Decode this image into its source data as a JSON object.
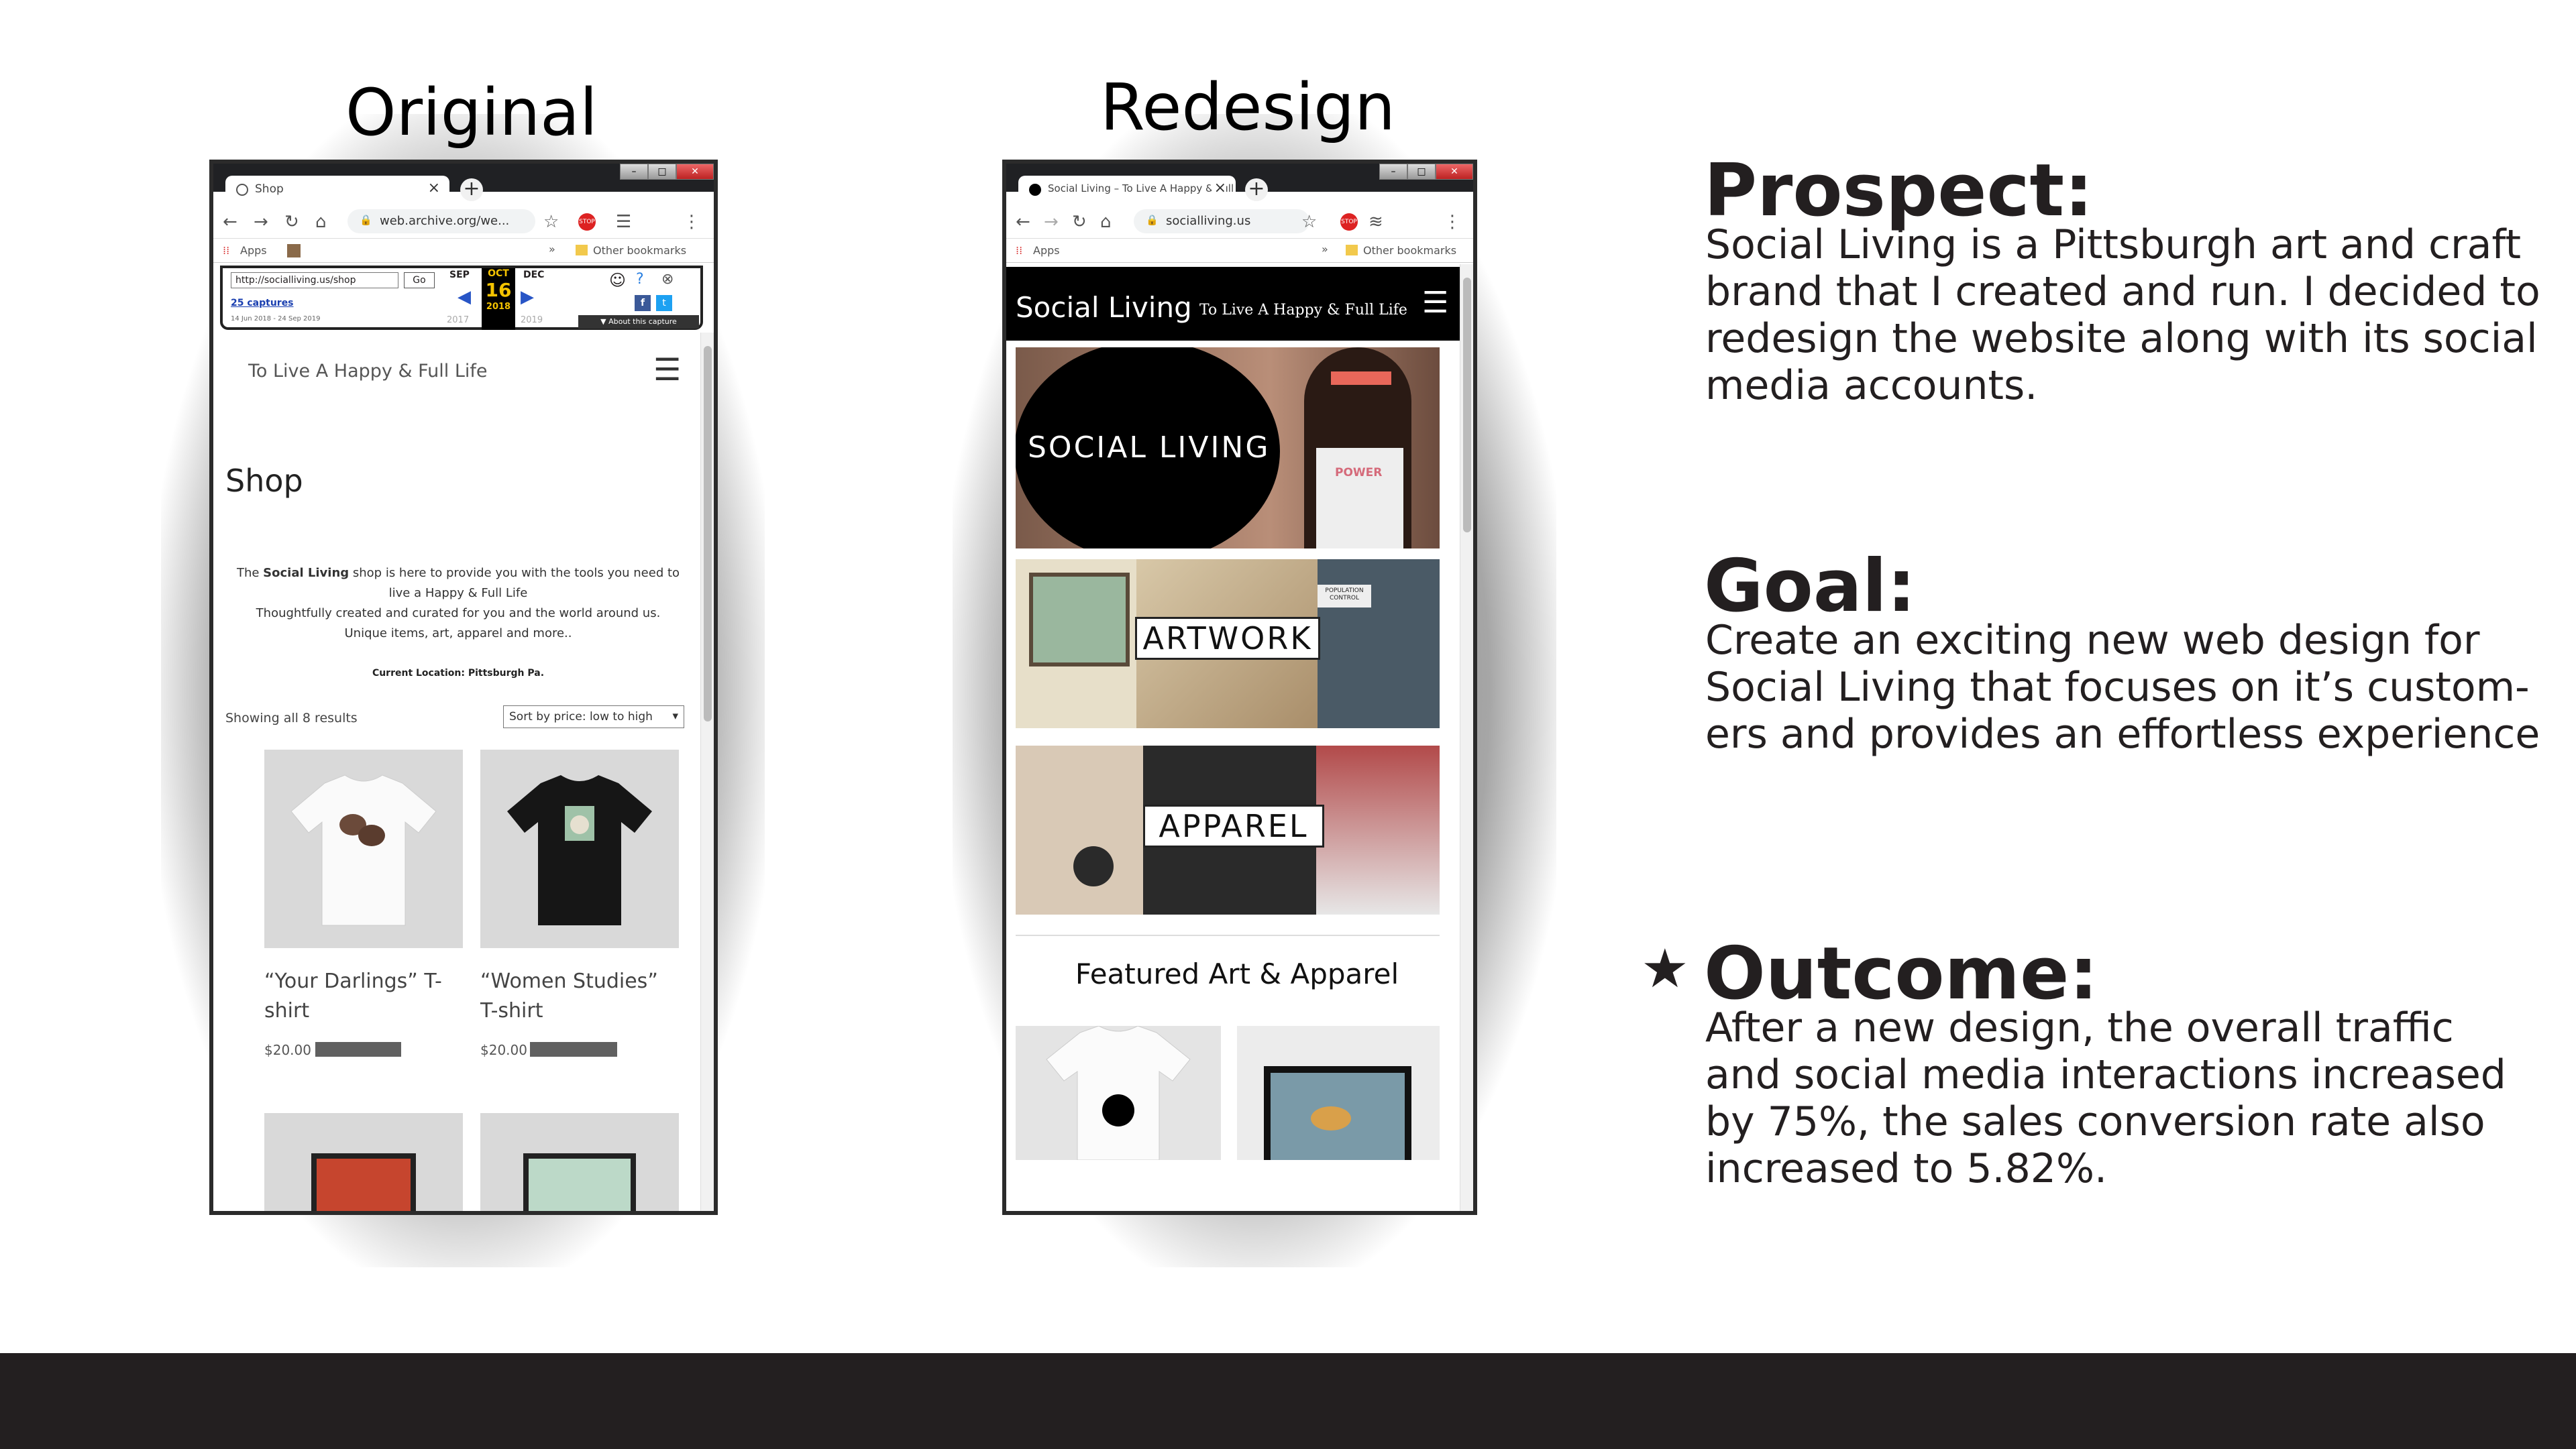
{
  "headings": {
    "original": "Original",
    "redesign": "Redesign"
  },
  "original_browser": {
    "tab_title": "Shop",
    "url": "web.archive.org/we...",
    "bookmarks": {
      "apps": "Apps",
      "other": "Other bookmarks"
    },
    "wayback": {
      "input_value": "http://socialliving.us/shop",
      "go": "Go",
      "captures": "25 captures",
      "date_range": "14 Jun 2018 - 24 Sep 2019",
      "months": [
        "SEP",
        "OCT",
        "DEC"
      ],
      "day": "16",
      "years": [
        "2017",
        "2018",
        "2019"
      ],
      "about": "About this capture"
    },
    "page": {
      "tagline": "To Live A Happy & Full Life",
      "title": "Shop",
      "intro_prefix": "The ",
      "intro_brand": "Social Living",
      "intro_rest": " shop is here to provide you with the tools you need to live a Happy & Full Life",
      "intro_line2": "Thoughtfully created and curated for you and the world around us.",
      "intro_line3": "Unique items, art, apparel and more..",
      "location": "Current Location: Pittsburgh Pa.",
      "results": "Showing all 8 results",
      "sort": "Sort by price: low to high",
      "products": [
        {
          "title": "“Your Darlings” T-shirt",
          "price": "$20.00"
        },
        {
          "title": "“Women Studies” T-shirt",
          "price": "$20.00"
        }
      ]
    }
  },
  "redesign_browser": {
    "tab_title": "Social Living – To Live A Happy & Full Life",
    "url": "socialliving.us",
    "bookmarks": {
      "apps": "Apps",
      "other": "Other bookmarks"
    },
    "page": {
      "brand": "Social Living",
      "tagline": "To Live A Happy & Full Life",
      "hero_logo": "SOCIAL LIVING",
      "shirt_text": "POWER",
      "artwork_label": "ARTWORK",
      "artwork_sticker": "POPULATION CONTROL",
      "apparel_label": "APPAREL",
      "featured": "Featured Art & Apparel"
    }
  },
  "sections": {
    "prospect": {
      "title": "Prospect:",
      "lines": [
        "Social Living is a Pittsburgh art and craft",
        "brand that I created and run. I decided to",
        "redesign the website along with its social",
        "media accounts."
      ]
    },
    "goal": {
      "title": "Goal:",
      "lines": [
        "Create an exciting new web design for",
        "Social Living that focuses on it’s custom-",
        "ers and provides an effortless experience"
      ]
    },
    "outcome": {
      "title": "Outcome:",
      "lines": [
        "After a new design, the overall traffic",
        "and social media interactions increased",
        "by 75%, the sales conversion rate also",
        "increased to 5.82%."
      ],
      "icon": "star-icon"
    }
  },
  "colors": {
    "footer_bar": "#231f20",
    "wayback_accent": "#f4c300",
    "redesign_header": "#000000"
  }
}
